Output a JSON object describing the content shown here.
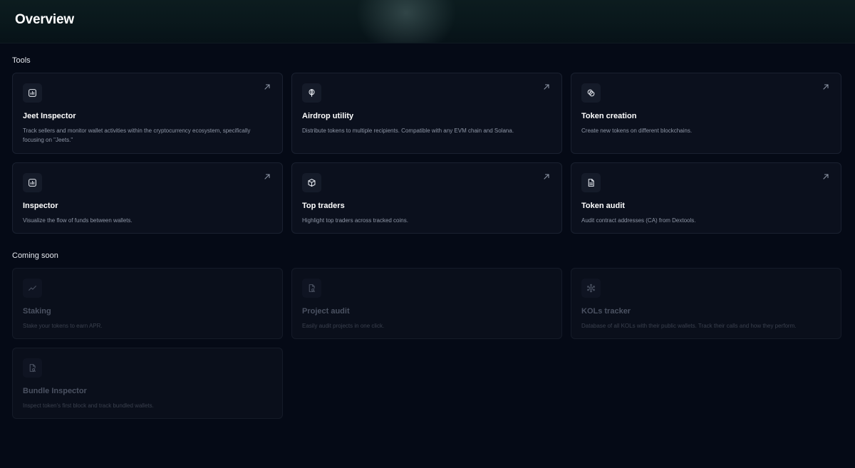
{
  "header": {
    "title": "Overview"
  },
  "sections": {
    "tools_title": "Tools",
    "coming_soon_title": "Coming soon"
  },
  "tools": [
    {
      "title": "Jeet Inspector",
      "description": "Track sellers and monitor wallet activities within the cryptocurrency ecosystem, specifically focusing on \"Jeets.\"",
      "icon": "bar-chart-icon"
    },
    {
      "title": "Airdrop utility",
      "description": "Distribute tokens to multiple recipients. Compatible with any EVM chain and Solana.",
      "icon": "balloon-icon"
    },
    {
      "title": "Token creation",
      "description": "Create new tokens on different blockchains.",
      "icon": "coins-icon"
    },
    {
      "title": "Inspector",
      "description": "Visualize the flow of funds between wallets.",
      "icon": "bar-chart-icon"
    },
    {
      "title": "Top traders",
      "description": "Highlight top traders across tracked coins.",
      "icon": "box-icon"
    },
    {
      "title": "Token audit",
      "description": "Audit contract addresses (CA) from Dextools.",
      "icon": "document-icon"
    }
  ],
  "coming_soon": [
    {
      "title": "Staking",
      "description": "Stake your tokens to earn APR.",
      "icon": "trend-line-icon"
    },
    {
      "title": "Project audit",
      "description": "Easily audit projects in one click.",
      "icon": "file-search-icon"
    },
    {
      "title": "KOLs tracker",
      "description": "Database of all KOLs with their public wallets. Track their calls and how they perform.",
      "icon": "network-icon"
    },
    {
      "title": "Bundle Inspector",
      "description": "Inspect token's first block and track bundled wallets.",
      "icon": "file-search-icon"
    }
  ],
  "colors": {
    "background": "#050a16",
    "card": "#0b101d",
    "card_border": "#1a2130",
    "muted_text": "#8e96a6",
    "disabled_text": "#4b5262"
  }
}
